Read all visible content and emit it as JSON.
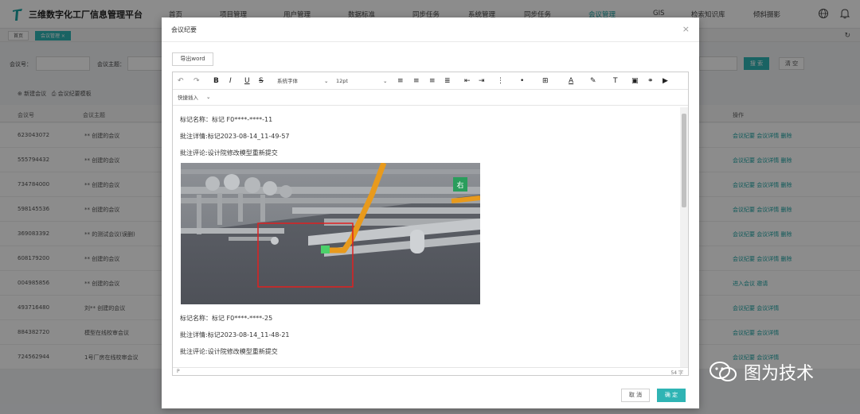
{
  "app": {
    "title": "三维数字化工厂信息管理平台"
  },
  "nav": [
    "首页",
    "项目管理",
    "用户管理",
    "数据标准",
    "同步任务",
    "系统管理",
    "同步任务",
    "会议管理",
    "GIS",
    "检索知识库",
    "倾斜摄影"
  ],
  "tabs": [
    "首页",
    "会议管理 ×"
  ],
  "filters": {
    "meeting_no": "会议号：",
    "meeting_subject": "会议主题："
  },
  "buttons": {
    "search": "搜 索",
    "clear": "清 空",
    "new_meeting": "新建会议",
    "meeting_template": "会议纪要模板"
  },
  "table": {
    "headers": [
      "会议号",
      "会议主题",
      "操作"
    ],
    "rows": [
      {
        "id": "623043072",
        "subject": "** 创建的会议",
        "ops": "会议纪要  会议详情  删除"
      },
      {
        "id": "555794432",
        "subject": "** 创建的会议",
        "ops": "会议纪要  会议详情  删除"
      },
      {
        "id": "734784000",
        "subject": "** 创建的会议",
        "ops": "会议纪要  会议详情  删除"
      },
      {
        "id": "598145536",
        "subject": "** 创建的会议",
        "ops": "会议纪要  会议详情  删除"
      },
      {
        "id": "369083392",
        "subject": "** 的测试会议(误删)",
        "ops": "会议纪要  会议详情  删除"
      },
      {
        "id": "608179200",
        "subject": "** 创建的会议",
        "ops": "会议纪要  会议详情  删除"
      },
      {
        "id": "004985856",
        "subject": "** 创建的会议",
        "ops": "进入会议  邀请"
      },
      {
        "id": "493716480",
        "subject": "刘** 创建的会议",
        "ops": "会议纪要  会议详情"
      },
      {
        "id": "884382720",
        "subject": "模型在线校审会议",
        "ops": "会议纪要  会议详情"
      },
      {
        "id": "724562944",
        "subject": "1号厂房在线校审会议",
        "ops": "会议纪要  会议详情"
      }
    ]
  },
  "modal": {
    "title": "会议纪要",
    "close": "×",
    "export_label": "导出word",
    "font_family": "系统字体",
    "font_size": "12pt",
    "quick_insert": "快捷插入",
    "lines": {
      "mark1_name": "标记名称：标记 F0****-****-11",
      "mark1_detail": "批注详情:标记2023-08-14_11-49-57",
      "mark1_comment": "批注评论:设计院修改模型重新提交",
      "mark2_name": "标记名称：标记 F0****-****-25",
      "mark2_detail": "批注详情:标记2023-08-14_11-48-21",
      "mark2_comment": "批注评论:设计院修改模型重新提交"
    },
    "status_p": "P",
    "word_count": "54 字",
    "cancel": "取 消",
    "ok": "确 定"
  },
  "watermark": "图为技术",
  "colors": {
    "accent": "#2fb4b4",
    "pipe": "#e89a1c",
    "marker": "#e02020"
  }
}
